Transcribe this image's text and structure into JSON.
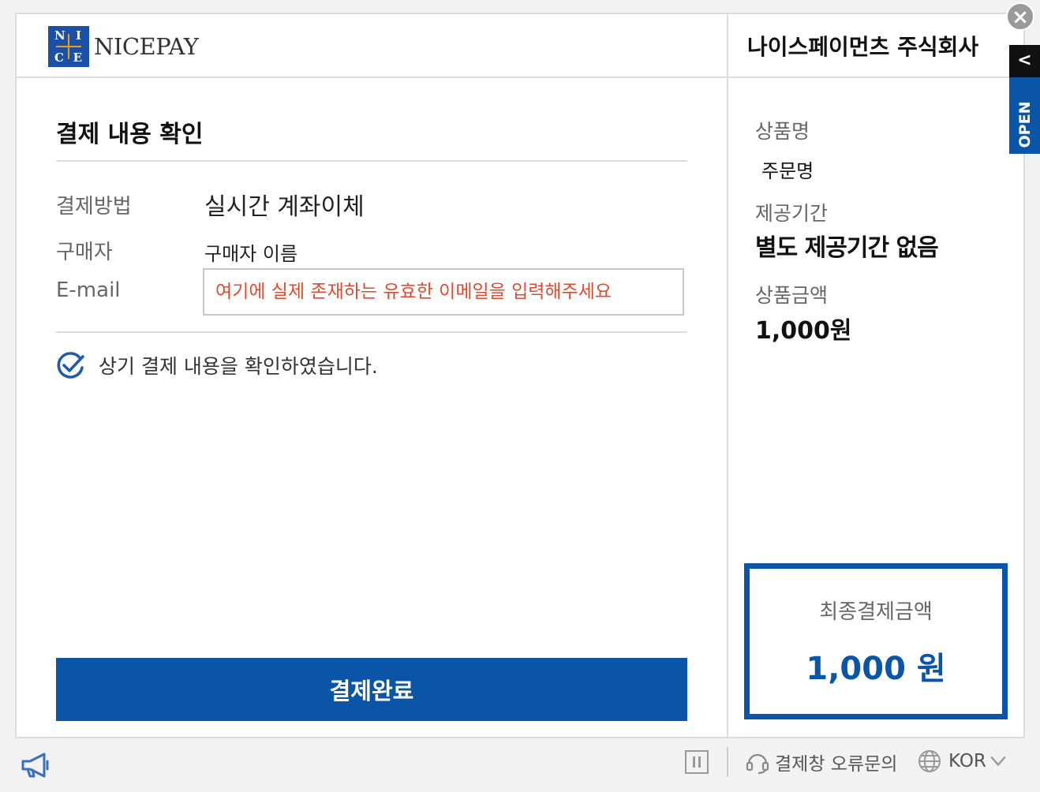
{
  "header": {
    "logo_text": "NICEPAY",
    "logo_letters": [
      "N",
      "I",
      "C",
      "E"
    ],
    "merchant_name": "나이스페이먼츠 주식회사"
  },
  "main": {
    "section_title": "결제 내용 확인",
    "payment_method_label": "결제방법",
    "payment_method_value": "실시간 계좌이체",
    "buyer_label": "구매자",
    "buyer_value": "구매자 이름",
    "email_label": "E-mail",
    "email_placeholder": "여기에 실제 존재하는 유효한 이메일을 입력해주세요",
    "email_value": "",
    "confirm_text": "상기 결제 내용을 확인하였습니다.",
    "confirm_checked": true,
    "submit_label": "결제완료"
  },
  "summary": {
    "product_name_label": "상품명",
    "product_name_value": "주문명",
    "period_label": "제공기간",
    "period_value": "별도 제공기간 없음",
    "amount_label": "상품금액",
    "amount_value": "1,000원",
    "final_label": "최종결제금액",
    "final_amount": "1,000 원"
  },
  "side_tab": {
    "label": "OPEN",
    "chevron": "<"
  },
  "close": {
    "label": "×"
  },
  "footer": {
    "error_inquiry": "결제창 오류문의",
    "language": "KOR"
  },
  "colors": {
    "brand_blue": "#0b55a8",
    "warning_red": "#e04a2f"
  },
  "icons": [
    "close-icon",
    "chevron-left-icon",
    "check-circle-icon",
    "megaphone-icon",
    "pause-icon",
    "headset-icon",
    "globe-icon",
    "chevron-down-icon"
  ]
}
